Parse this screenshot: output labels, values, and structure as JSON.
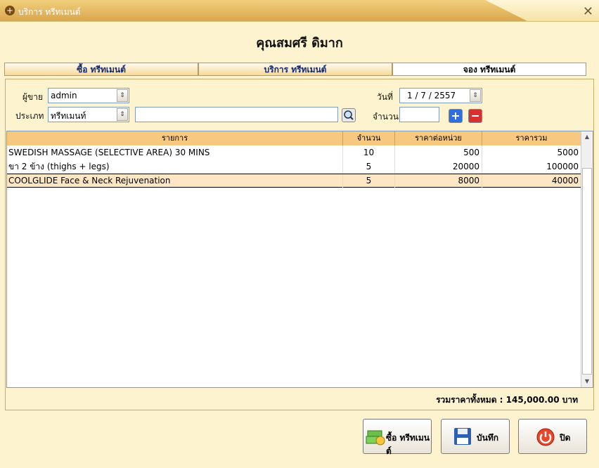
{
  "window": {
    "title": "บริการ ทรีทเมนต์",
    "close_icon": "close-icon"
  },
  "customer_name": "คุณสมศรี    ดิมาก",
  "tabs": [
    "ซื้อ ทรีทเมนต์",
    "บริการ ทรีทเมนต์",
    "จอง ทรีทเมนต์"
  ],
  "form": {
    "seller_label": "ผู้ขาย",
    "seller_value": "admin",
    "type_label": "ประเภท",
    "type_value": "ทรีทเมนท์",
    "date_label": "วันที่",
    "date_value": "1 / 7 / 2557",
    "qty_label": "จำนวน"
  },
  "table": {
    "headers": [
      "รายการ",
      "จำนวน",
      "ราคาต่อหน่วย",
      "ราคารวม"
    ],
    "rows": [
      [
        "SWEDISH MASSAGE (SELECTIVE AREA) 30 MINS",
        "10",
        "500",
        "5000"
      ],
      [
        "ขา 2 ข้าง (thighs + legs)",
        "5",
        "20000",
        "100000"
      ],
      [
        "COOLGLIDE Face & Neck Rejuvenation",
        "5",
        "8000",
        "40000"
      ]
    ]
  },
  "total_text": "รวมราคาทั้งหมด  : 145,000.00 บาท",
  "buttons": {
    "buy": "ซื้อ ทรีทเมนต์",
    "save": "บันทึก",
    "close": "ปิด"
  },
  "colors": {
    "header": "#f6c880",
    "selected_row": "#fce6c4",
    "accent": "#d9a64e"
  }
}
